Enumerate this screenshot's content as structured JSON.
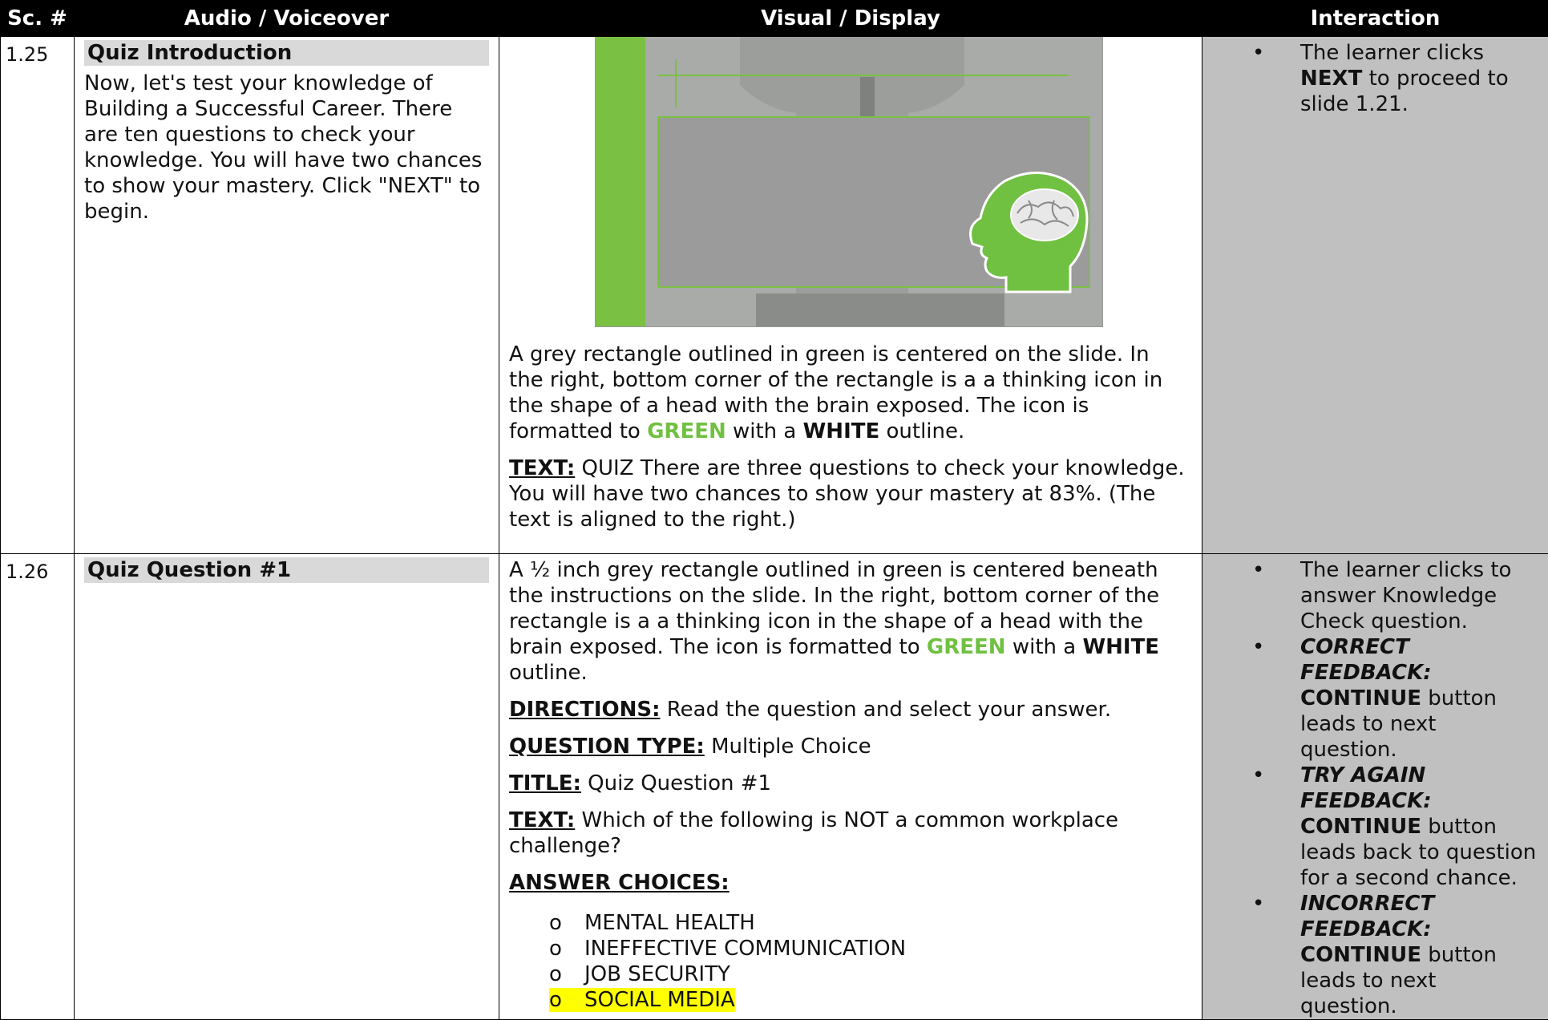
{
  "headers": {
    "sc": "Sc. #",
    "audio": "Audio / Voiceover",
    "visual": "Visual / Display",
    "interaction": "Interaction"
  },
  "rows": [
    {
      "sc": "1.25",
      "audio_title": "Quiz Introduction",
      "audio_text": "Now, let's test your knowledge of Building a Successful Career.  There are ten questions to check your knowledge.  You will have two chances to show your mastery. Click \"NEXT\" to begin.",
      "visual": {
        "desc_part1": "A grey rectangle outlined in green is centered on the slide. In the right, bottom corner of the rectangle is a a thinking icon in the shape of a head with the brain exposed. The icon is formatted to ",
        "desc_green": "GREEN",
        "desc_part2": " with a ",
        "desc_white": "WHITE",
        "desc_part3": " outline.",
        "text_label": "TEXT:",
        "text_value": " QUIZ There are three questions to check your knowledge.  You will have two chances to show your mastery at 83%. (The text is aligned to the right.)"
      },
      "interaction": {
        "bullet_part1": "The learner clicks ",
        "bullet_bold": "NEXT",
        "bullet_part2": " to proceed to slide 1.21."
      }
    },
    {
      "sc": "1.26",
      "audio_title": "Quiz Question #1",
      "visual": {
        "desc_part1": "A ½ inch grey rectangle outlined in green is centered beneath the instructions on the slide. In the right, bottom corner of the rectangle is a a thinking icon in the shape of a head with the brain exposed. The icon is formatted to ",
        "desc_green": "GREEN",
        "desc_part2": " with a ",
        "desc_white": "WHITE",
        "desc_part3": " outline.",
        "directions_label": "DIRECTIONS:",
        "directions_value": " Read the question and select your answer.",
        "qtype_label": "QUESTION TYPE:",
        "qtype_value": " Multiple Choice",
        "title_label": "TITLE:",
        "title_value": " Quiz Question #1",
        "text_label": "TEXT:",
        "text_value": " Which of the following is NOT a common workplace challenge?",
        "choices_label": "ANSWER CHOICES:",
        "choices": [
          "MENTAL HEALTH",
          "INEFFECTIVE COMMUNICATION",
          "JOB SECURITY",
          "SOCIAL MEDIA"
        ],
        "choice_bullet": "o"
      },
      "interaction": {
        "b1": "The learner clicks to answer Knowledge Check question.",
        "b2_bi": "CORRECT FEEDBACK:",
        "b2_bold": "CONTINUE",
        "b2_rest": " button leads to next question.",
        "b3_bi": "TRY AGAIN FEEDBACK:",
        "b3_bold": " CONTINUE",
        "b3_rest": " button leads back to question for a second chance.",
        "b4_bi": "INCORRECT FEEDBACK:",
        "b4_bold": " CONTINUE",
        "b4_rest": " button leads to next question."
      }
    }
  ],
  "bullet_char": "•",
  "colors": {
    "header_bg": "#000000",
    "interaction_bg": "#c0c0c0",
    "accent_green": "#70c041",
    "highlight": "#ffff00"
  }
}
